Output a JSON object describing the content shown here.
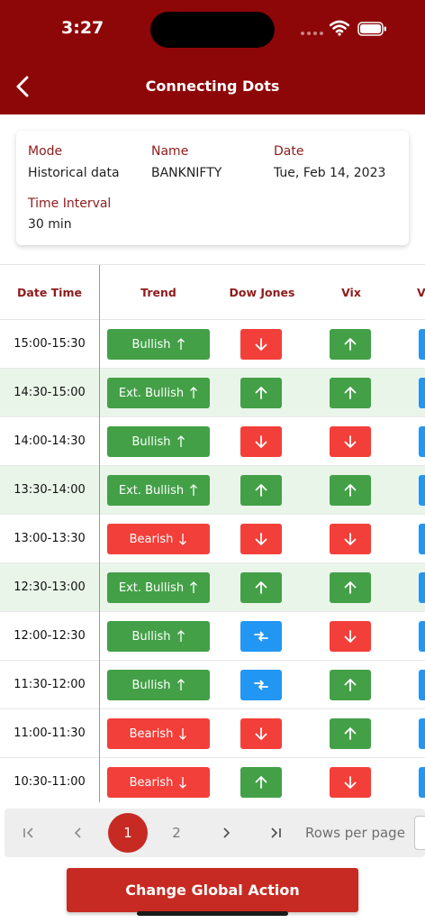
{
  "status": {
    "time": "3:27"
  },
  "nav": {
    "title": "Connecting Dots"
  },
  "info": {
    "mode_label": "Mode",
    "mode_value": "Historical data",
    "name_label": "Name",
    "name_value": "BANKNIFTY",
    "date_label": "Date",
    "date_value": "Tue, Feb 14, 2023",
    "interval_label": "Time Interval",
    "interval_value": "30 min"
  },
  "table": {
    "headers": [
      "Date Time",
      "Trend",
      "Dow Jones",
      "Vix",
      "V"
    ],
    "rows": [
      {
        "time": "15:00-15:30",
        "trend": "Bullish",
        "dow": "down",
        "vix": "up",
        "shaded": false
      },
      {
        "time": "14:30-15:00",
        "trend": "Ext. Bullish",
        "dow": "up",
        "vix": "up",
        "shaded": true
      },
      {
        "time": "14:00-14:30",
        "trend": "Bullish",
        "dow": "down",
        "vix": "down",
        "shaded": false
      },
      {
        "time": "13:30-14:00",
        "trend": "Ext. Bullish",
        "dow": "up",
        "vix": "up",
        "shaded": true
      },
      {
        "time": "13:00-13:30",
        "trend": "Bearish",
        "dow": "down",
        "vix": "down",
        "shaded": false
      },
      {
        "time": "12:30-13:00",
        "trend": "Ext. Bullish",
        "dow": "up",
        "vix": "up",
        "shaded": true
      },
      {
        "time": "12:00-12:30",
        "trend": "Bullish",
        "dow": "neutral",
        "vix": "down",
        "shaded": false
      },
      {
        "time": "11:30-12:00",
        "trend": "Bullish",
        "dow": "neutral",
        "vix": "up",
        "shaded": false
      },
      {
        "time": "11:00-11:30",
        "trend": "Bearish",
        "dow": "down",
        "vix": "up",
        "shaded": false
      },
      {
        "time": "10:30-11:00",
        "trend": "Bearish",
        "dow": "up",
        "vix": "down",
        "shaded": false
      }
    ]
  },
  "colors": {
    "header": "#8e0708",
    "bullish": "#43a047",
    "bearish": "#f23f3a",
    "neutral": "#2196f3",
    "accent": "#c62a22"
  },
  "pagination": {
    "current": "1",
    "next_page": "2",
    "rows_per_page_label": "Rows per page"
  },
  "footer": {
    "action_label": "Change Global Action"
  }
}
